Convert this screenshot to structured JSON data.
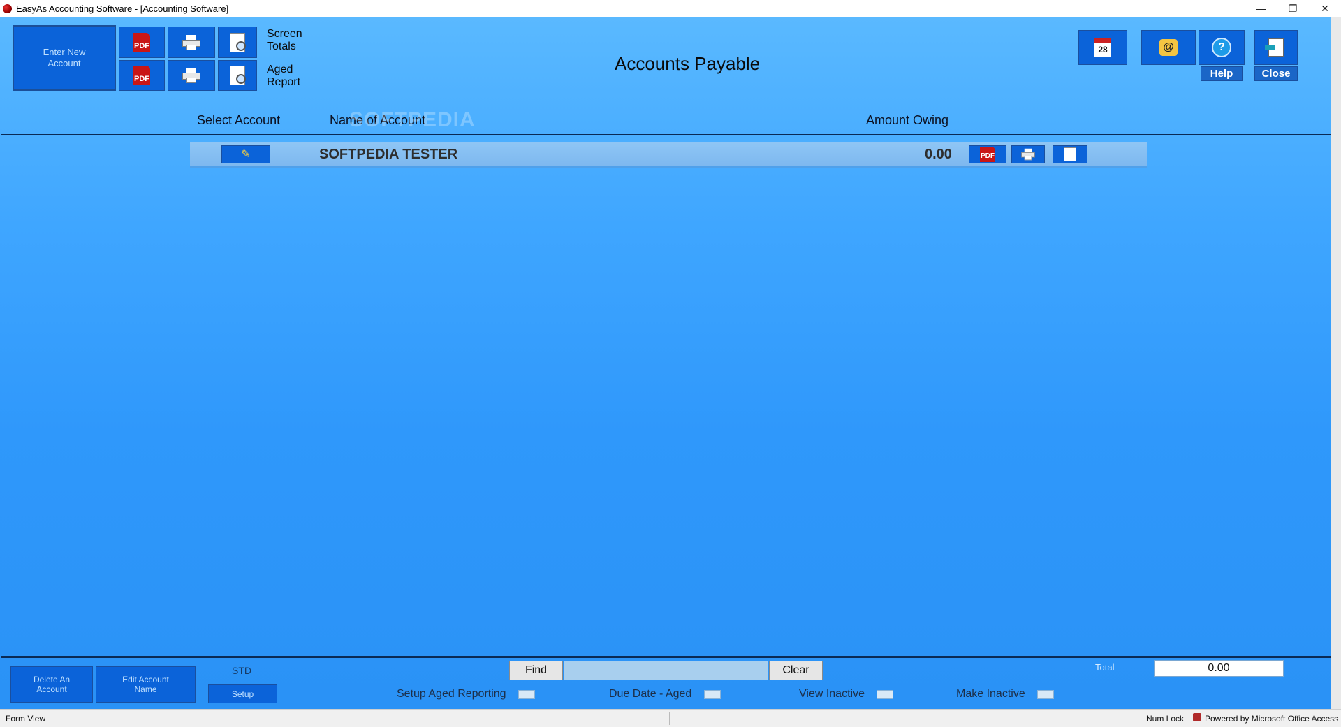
{
  "window": {
    "title": "EasyAs Accounting Software - [Accounting Software]",
    "minimize": "—",
    "restore": "❐",
    "close": "✕"
  },
  "toolbar": {
    "enter_new_account": "Enter New Account",
    "screen_totals": "Screen Totals",
    "aged_report": "Aged Report",
    "pdf_label": "PDF"
  },
  "page": {
    "title": "Accounts Payable",
    "watermark": "SOFTPEDIA"
  },
  "top_right": {
    "calendar_day": "28",
    "email_symbol": "@",
    "help_symbol": "?",
    "help_label": "Help",
    "close_label": "Close"
  },
  "columns": {
    "select_account": "Select Account",
    "name_of_account": "Name of Account",
    "amount_owing": "Amount Owing"
  },
  "rows": [
    {
      "name": "SOFTPEDIA TESTER",
      "amount": "0.00",
      "pdf": "PDF"
    }
  ],
  "footer": {
    "delete_account": "Delete An Account",
    "edit_account_name": "Edit Account Name",
    "std": "STD",
    "setup": "Setup",
    "find": "Find",
    "find_value": "",
    "clear": "Clear",
    "total_label": "Total",
    "total_value": "0.00",
    "setup_aged_reporting": "Setup Aged Reporting",
    "due_date_aged": "Due Date - Aged",
    "view_inactive": "View Inactive",
    "make_inactive": "Make Inactive"
  },
  "statusbar": {
    "left": "Form View",
    "num_lock": "Num Lock",
    "powered_by": "Powered by Microsoft Office Access"
  },
  "colors": {
    "form_background": "#3fa6ff",
    "button_blue": "#0b63d9",
    "row_background": "#8fc6f5",
    "pdf_red": "#c91616"
  }
}
